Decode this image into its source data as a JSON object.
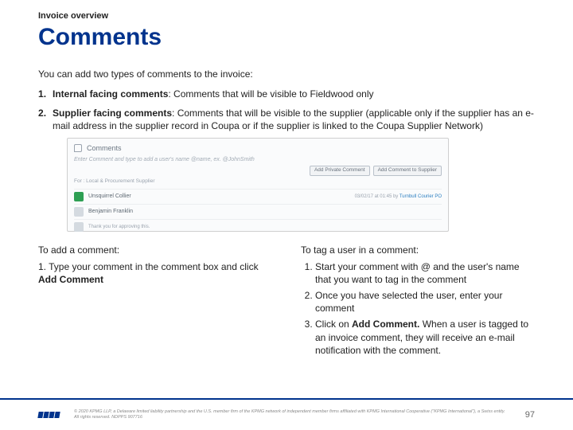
{
  "preTitle": "Invoice overview",
  "title": "Comments",
  "intro": "You can add two types of comments to the invoice:",
  "items": [
    {
      "label": "Internal facing comments",
      "desc": ": Comments that will be visible to Fieldwood only"
    },
    {
      "label": "Supplier facing comments",
      "desc": ": Comments that will be visible to the supplier (applicable only if the supplier has an e-mail address in the supplier record in Coupa or if the supplier is linked to the Coupa Supplier Network)"
    }
  ],
  "shot": {
    "heading": "Comments",
    "placeholder": "Enter Comment and type to add a user's name @name, ex. @JohnSmith",
    "btnPrivate": "Add Private Comment",
    "btnSupplier": "Add Comment to Supplier",
    "filterLabel": "For : Local & Procurement Supplier",
    "c1": {
      "name": "Unsquirrel Collier",
      "rightLink": "Turnbull Courier PO",
      "date": "03/02/17 at 01:45 by"
    },
    "c2": {
      "name": "Benjamin Franklin",
      "meta": ""
    },
    "c3": {
      "name": "",
      "meta": "Thank you for approving this."
    }
  },
  "left": {
    "head": "To add a comment:",
    "step": "1. Type your comment in the comment box and click ",
    "stepBold": "Add Comment"
  },
  "right": {
    "head": "To tag a user in a comment:",
    "steps": [
      "Start your comment with @ and the user's name that you want to tag in the comment",
      "Once you have selected the user, enter your comment"
    ],
    "step3a": "Click on ",
    "step3bold": "Add Comment.",
    "step3b": " When a user is tagged to an invoice comment, they will receive an e-mail notification with the comment."
  },
  "legal": "© 2020 KPMG LLP, a Delaware limited liability partnership and the U.S. member firm of the KPMG network of independent member firms affiliated with KPMG International Cooperative (\"KPMG International\"), a Swiss entity. All rights reserved. NDPPS 907716",
  "pageNumber": "97"
}
